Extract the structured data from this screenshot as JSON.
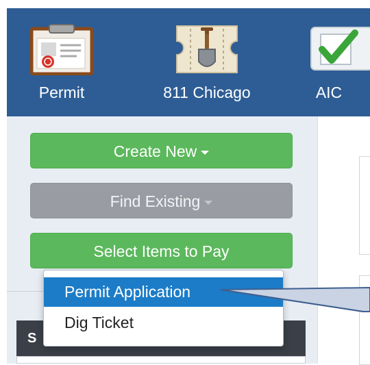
{
  "nav": {
    "items": [
      {
        "label": "Permit",
        "icon": "permit-clipboard-icon"
      },
      {
        "label": "811 Chicago",
        "icon": "shovel-ticket-icon"
      },
      {
        "label": "AIC",
        "icon": "checkmark-icon"
      }
    ],
    "bar_color": "#2e5d95"
  },
  "actions": {
    "create_new": "Create New",
    "find_existing": "Find Existing",
    "select_items": "Select Items to Pay"
  },
  "menu": {
    "items": [
      {
        "label": "Permit Application",
        "highlighted": true
      },
      {
        "label": "Dig Ticket",
        "highlighted": false
      }
    ],
    "highlight_color": "#1c7cc7"
  },
  "panel": {
    "header_partial": "S"
  },
  "colors": {
    "green": "#5cb85c",
    "gray": "#999da3",
    "panel_dark": "#3b4048"
  }
}
